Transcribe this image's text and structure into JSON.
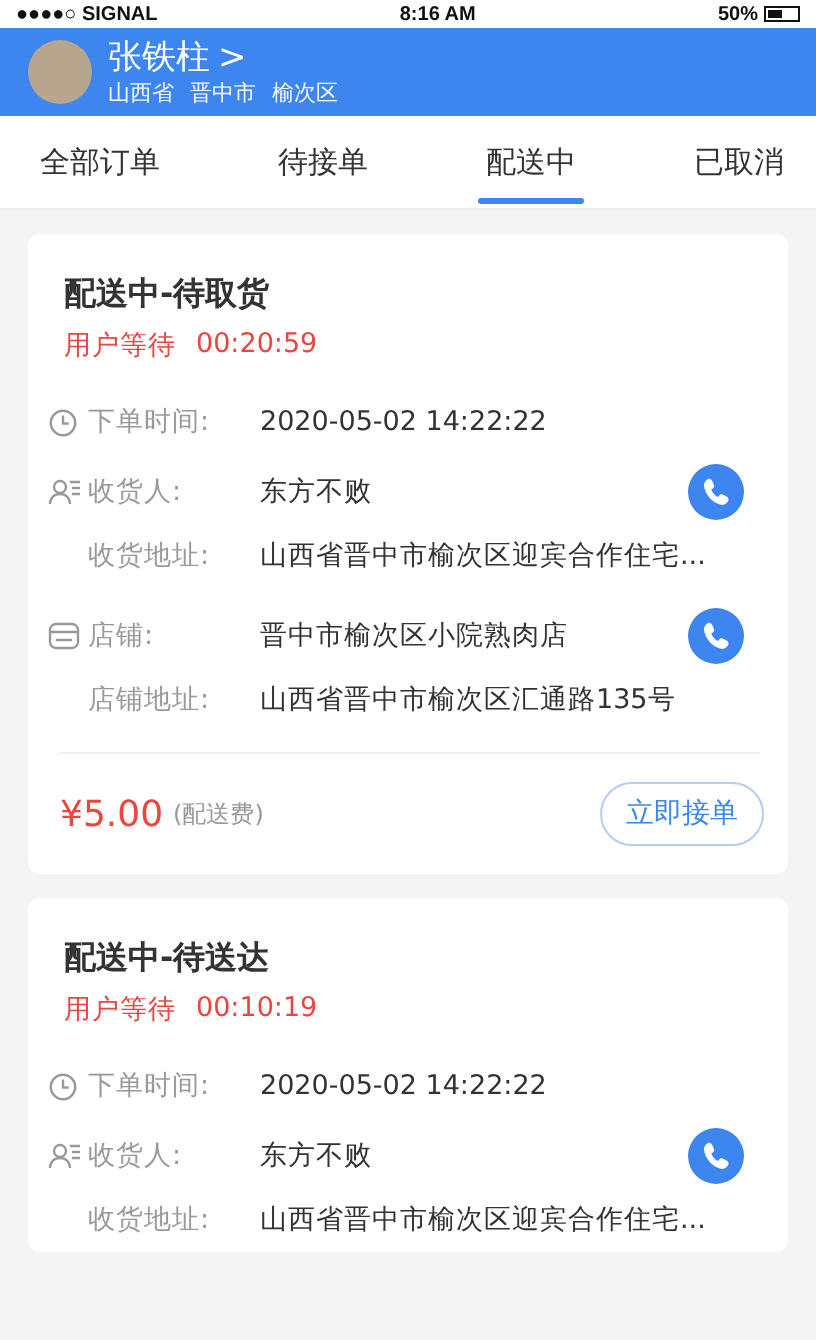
{
  "status_bar": {
    "carrier": "●●●●○ SIGNAL",
    "time": "8:16 AM",
    "battery": "50%"
  },
  "profile": {
    "name": "张铁柱",
    "arrow": ">",
    "region": [
      "山西省",
      "晋中市",
      "榆次区"
    ]
  },
  "tabs": [
    {
      "label": "全部订单",
      "selected": false
    },
    {
      "label": "待接单",
      "selected": false
    },
    {
      "label": "配送中",
      "selected": true
    },
    {
      "label": "已取消",
      "selected": false
    }
  ],
  "orders": [
    {
      "title": "配送中-待取货",
      "wait_label": "用户等待",
      "wait_time": "00:20:59",
      "rows": [
        {
          "kind": "time",
          "label": "下单时间:",
          "value": "2020-05-02  14:22:22"
        },
        {
          "kind": "person",
          "label": "收货人:",
          "value": "东方不败"
        },
        {
          "kind": "address",
          "label": "收货地址:",
          "value": "山西省晋中市榆次区迎宾合作住宅..."
        },
        {
          "kind": "store",
          "label": "店铺:",
          "value": "晋中市榆次区小院熟肉店"
        },
        {
          "kind": "address",
          "label": "店铺地址:",
          "value": "山西省晋中市榆次区汇通路135号"
        }
      ],
      "footer": {
        "price": "¥5.00",
        "fee_note": "(配送费)",
        "button": "立即接单"
      }
    },
    {
      "title": "配送中-待送达",
      "wait_label": "用户等待",
      "wait_time": "00:10:19",
      "rows": [
        {
          "kind": "time",
          "label": "下单时间:",
          "value": "2020-05-02  14:22:22"
        },
        {
          "kind": "person",
          "label": "收货人:",
          "value": "东方不败"
        },
        {
          "kind": "address",
          "label": "收货地址:",
          "value": "山西省晋中市榆次区迎宾合作住宅..."
        }
      ]
    }
  ]
}
